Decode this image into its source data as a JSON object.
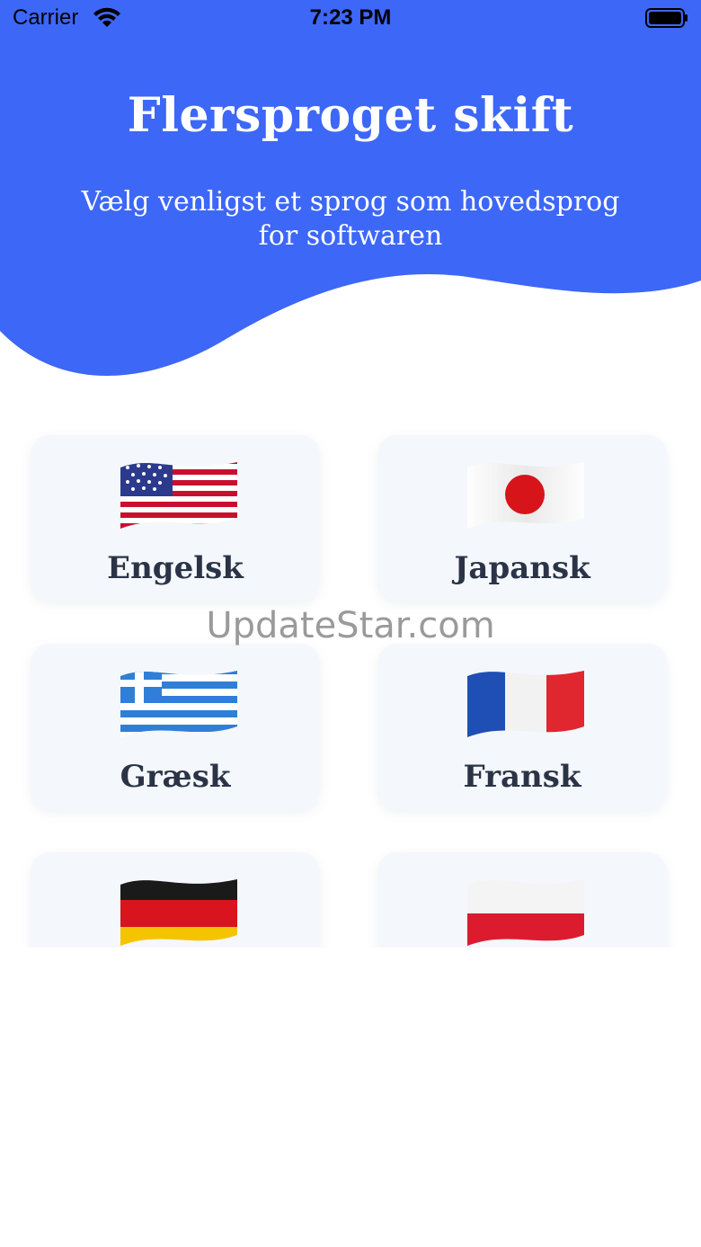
{
  "status_bar": {
    "carrier": "Carrier",
    "time": "7:23 PM"
  },
  "header": {
    "title": "Flersproget skift",
    "subtitle_line1": "Vælg venligst et sprog som hovedsprog",
    "subtitle_line2": "for softwaren",
    "background_color": "#3D67F7"
  },
  "languages": [
    {
      "label": "Engelsk",
      "flag_icon": "us-flag-icon"
    },
    {
      "label": "Japansk",
      "flag_icon": "japan-flag-icon"
    },
    {
      "label": "Græsk",
      "flag_icon": "greece-flag-icon"
    },
    {
      "label": "Fransk",
      "flag_icon": "france-flag-icon"
    },
    {
      "label": "",
      "flag_icon": "germany-flag-icon"
    },
    {
      "label": "",
      "flag_icon": "poland-flag-icon"
    }
  ],
  "watermark": "UpdateStar.com"
}
